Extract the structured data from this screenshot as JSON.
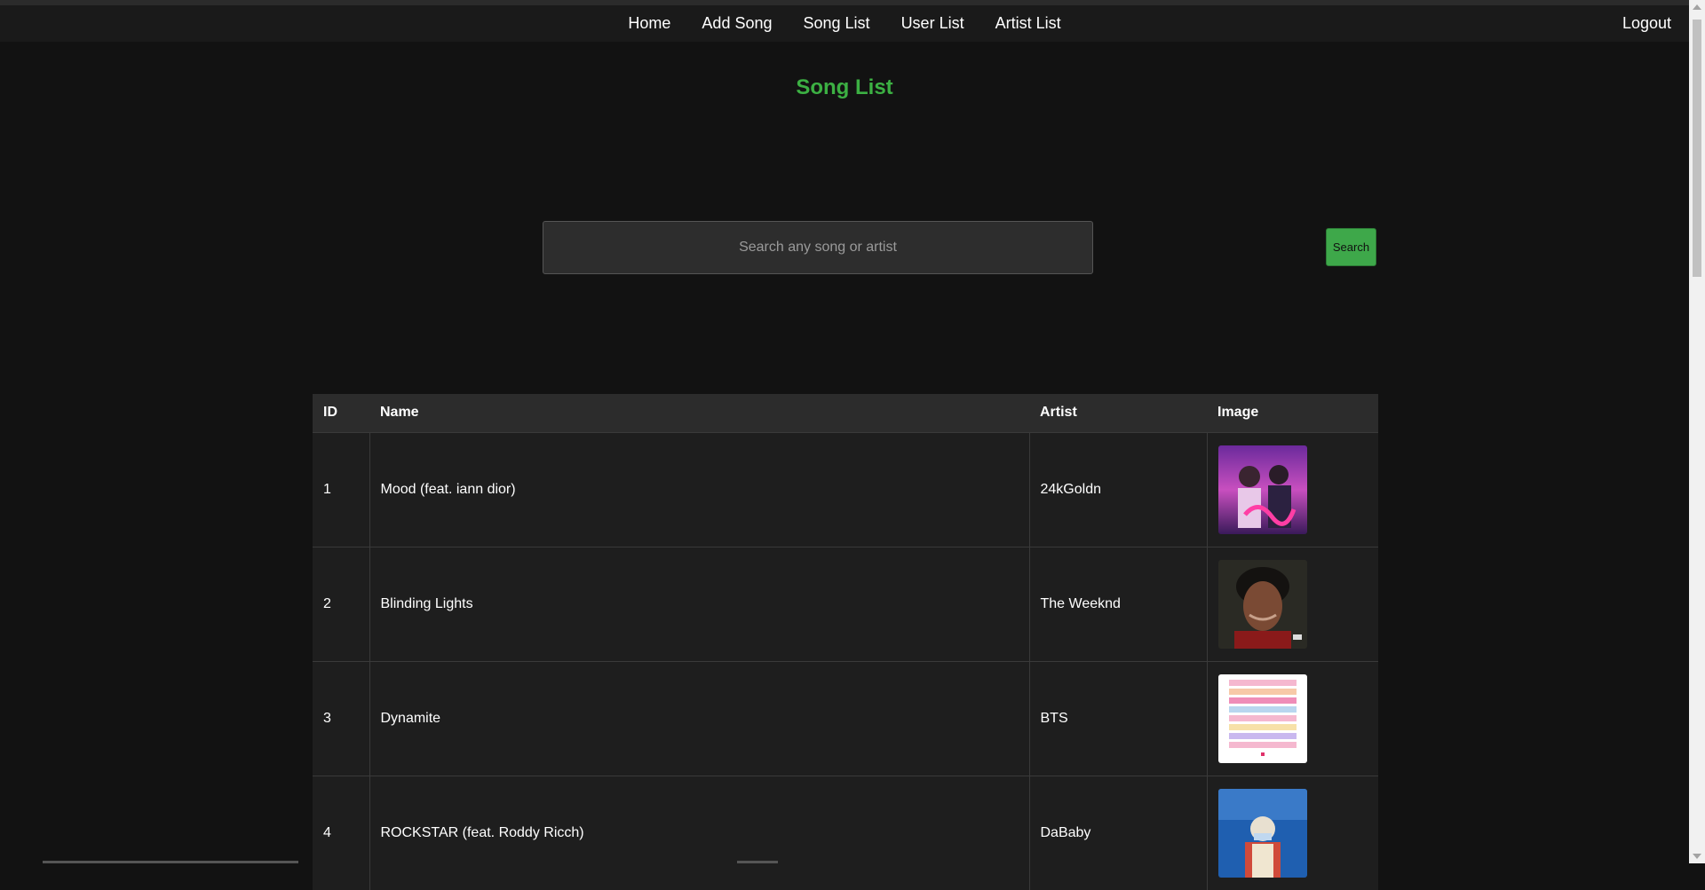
{
  "nav": {
    "links": [
      "Home",
      "Add Song",
      "Song List",
      "User List",
      "Artist List"
    ],
    "logout": "Logout"
  },
  "page": {
    "title": "Song List"
  },
  "search": {
    "placeholder": "Search any song or artist",
    "value": "",
    "button_label": "Search"
  },
  "table": {
    "headers": [
      "ID",
      "Name",
      "Artist",
      "Image"
    ],
    "rows": [
      {
        "id": "1",
        "name": "Mood (feat. iann dior)",
        "artist": "24kGoldn",
        "image": "album-cover-mood"
      },
      {
        "id": "2",
        "name": "Blinding Lights",
        "artist": "The Weeknd",
        "image": "album-cover-after-hours"
      },
      {
        "id": "3",
        "name": "Dynamite",
        "artist": "BTS",
        "image": "album-cover-dynamite"
      },
      {
        "id": "4",
        "name": "ROCKSTAR (feat. Roddy Ricch)",
        "artist": "DaBaby",
        "image": "album-cover-blame-it-on-baby"
      }
    ]
  },
  "colors": {
    "accent": "#3cb043",
    "background": "#121212",
    "navbar": "#1a1a1a",
    "table_header": "#2c2c2c",
    "table_body": "#1e1e1e"
  }
}
